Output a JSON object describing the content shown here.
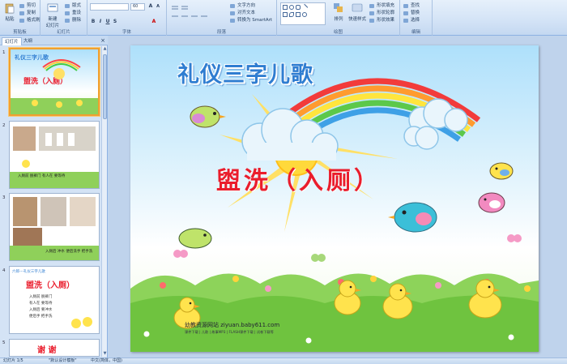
{
  "ribbon": {
    "clipboard": {
      "paste": "粘贴",
      "cut": "剪切",
      "copy": "复制",
      "format_painter": "格式刷",
      "label": "剪贴板"
    },
    "slides": {
      "new_slide": "新建",
      "new_slide2": "幻灯片",
      "layout": "版式",
      "reset": "重设",
      "delete": "删除",
      "label": "幻灯片"
    },
    "font": {
      "name": "",
      "size": "60",
      "label": "字体"
    },
    "paragraph": {
      "text_direction": "文字方向",
      "align_text": "对齐文本",
      "smartart": "转换为 SmartArt",
      "label": "段落"
    },
    "drawing": {
      "arrange": "排列",
      "quick_styles": "快速样式",
      "shape_fill": "形状填充",
      "shape_outline": "形状轮廓",
      "shape_effects": "形状效果",
      "label": "绘图"
    },
    "editing": {
      "find": "查找",
      "replace": "替换",
      "select": "选择",
      "label": "编辑"
    }
  },
  "panel": {
    "tab_slides": "幻灯片",
    "tab_outline": "大纲",
    "close": "×",
    "thumbs": [
      {
        "num": "1",
        "title": "礼仪三字儿歌",
        "heading": "盥洗（入厕）"
      },
      {
        "num": "2",
        "caption": "入厕前 脱裤门  有人在  要等待"
      },
      {
        "num": "3",
        "caption": "入厕后 冲水  便后洗手  把手洗"
      },
      {
        "num": "4",
        "title": "六郎---礼仪三字儿歌",
        "heading": "盥洗（入厕）",
        "lines": [
          "入厕前  脱裤门",
          "有人在  要等待",
          "入厕后  要冲水",
          "便后手  把手洗"
        ]
      },
      {
        "num": "5",
        "heading": "谢  谢"
      }
    ]
  },
  "slide": {
    "title": "礼仪三字儿歌",
    "heading": "盥洗（入厕）",
    "credit": "幼教资源网站  ziyuan.baby611.com",
    "credit_small": "课件下载 | 儿歌 | 故事MP3 | FLASH课件下载 | 试卷下载等"
  },
  "status": {
    "slide_info": "幻灯片 1/5",
    "theme": "\"默认设计模板\"",
    "language": "中文(简体，中国)"
  },
  "colors": {
    "title_blue": "#2f7dd1",
    "heading_red": "#ea1d2c",
    "ribbon_bg": "#d3e3f6",
    "selection": "#f0a030"
  }
}
